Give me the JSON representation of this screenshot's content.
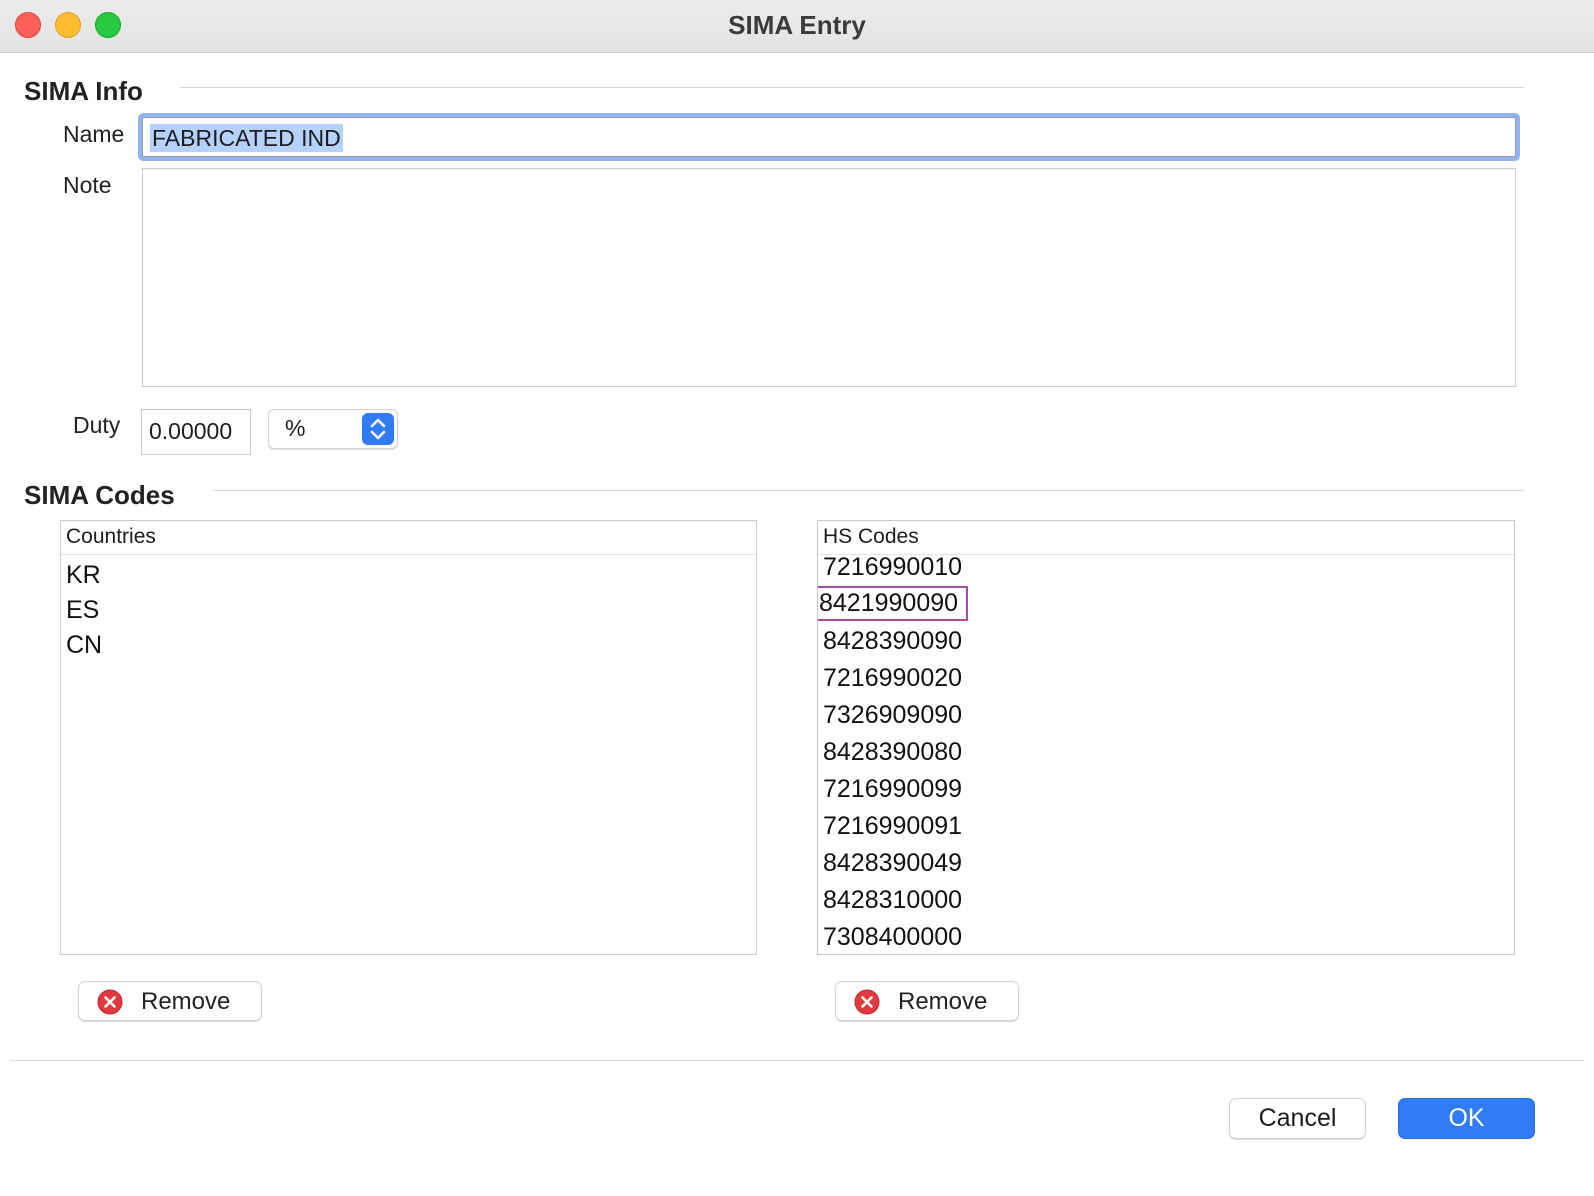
{
  "window": {
    "title": "SIMA Entry"
  },
  "sima_info": {
    "section_title": "SIMA Info",
    "name_label": "Name",
    "name_value": "FABRICATED IND",
    "note_label": "Note",
    "note_value": "",
    "duty_label": "Duty",
    "duty_value": "0.00000",
    "duty_unit": "%"
  },
  "sima_codes": {
    "section_title": "SIMA Codes",
    "countries": {
      "header": "Countries",
      "items": [
        "KR",
        "ES",
        "CN"
      ],
      "remove_label": "Remove"
    },
    "hs_codes": {
      "header": "HS Codes",
      "items": [
        "7216990010",
        "8421990090",
        "8428390090",
        "7216990020",
        "7326909090",
        "8428390080",
        "7216990099",
        "7216990091",
        "8428390049",
        "8428310000",
        "7308400000"
      ],
      "focused_item": "8421990090",
      "remove_label": "Remove"
    }
  },
  "footer": {
    "cancel_label": "Cancel",
    "ok_label": "OK"
  },
  "colors": {
    "accent": "#2f7cf6",
    "focus_ring": "#90b3f5",
    "selection": "#b4d2fc",
    "remove_icon": "#e0393e"
  }
}
